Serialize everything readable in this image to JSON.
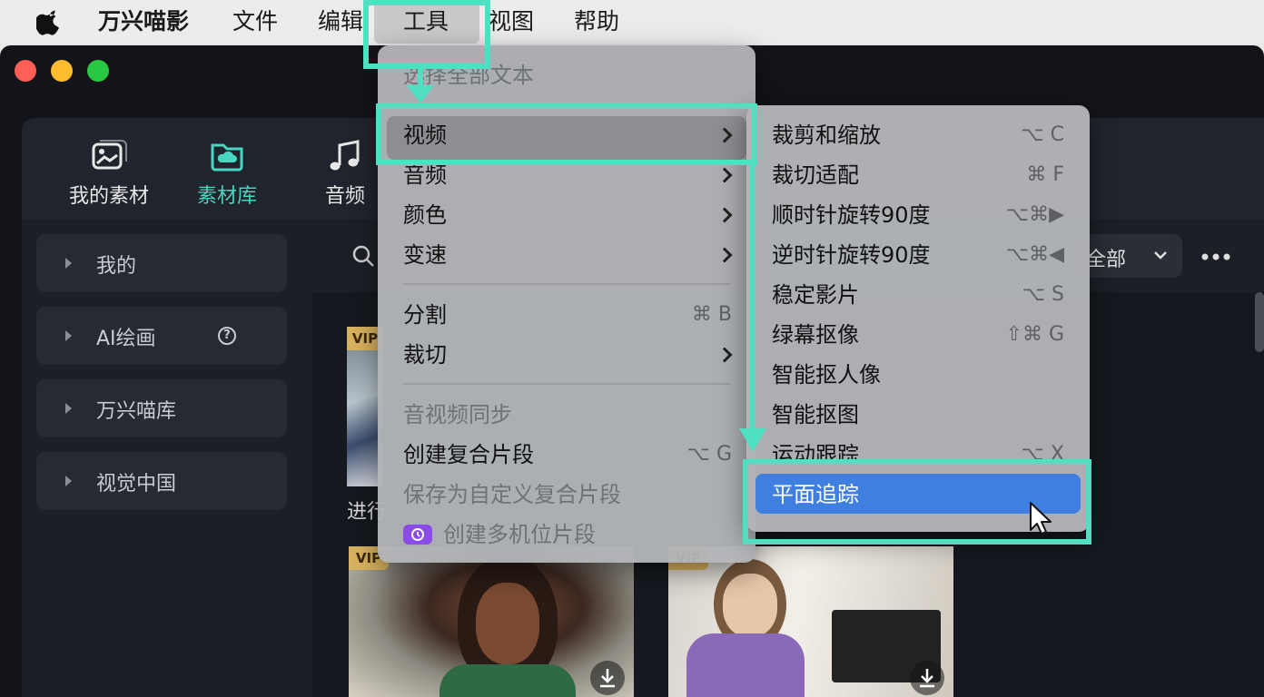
{
  "menubar": {
    "app_name": "万兴喵影",
    "items": [
      "文件",
      "编辑",
      "工具",
      "视图",
      "帮助"
    ]
  },
  "tabs": [
    {
      "label": "我的素材",
      "icon": "image-icon"
    },
    {
      "label": "素材库",
      "icon": "cloud-folder-icon"
    },
    {
      "label": "音频",
      "icon": "music-note-icon"
    }
  ],
  "sidebar": {
    "items": [
      {
        "label": "我的"
      },
      {
        "label": "AI绘画",
        "help": "?"
      },
      {
        "label": "万兴喵库"
      },
      {
        "label": "视觉中国"
      }
    ]
  },
  "toolbar": {
    "filter_label": "全部"
  },
  "thumbs": {
    "vip": "VIP",
    "caption": "进行"
  },
  "tools_menu": {
    "select_all_text": "选择全部文本",
    "video": "视频",
    "audio": "音频",
    "color": "颜色",
    "speed": "变速",
    "split": "分割",
    "split_shortcut": "⌘ B",
    "crop": "裁切",
    "av_sync": "音视频同步",
    "create_compound": "创建复合片段",
    "create_compound_shortcut": "⌥ G",
    "save_custom_compound": "保存为自定义复合片段",
    "create_multicam": "创建多机位片段"
  },
  "video_submenu": {
    "items": [
      {
        "label": "裁剪和缩放",
        "shortcut": "⌥ C"
      },
      {
        "label": "裁切适配",
        "shortcut": "⌘ F"
      },
      {
        "label": "顺时针旋转90度",
        "shortcut": "⌥⌘▶"
      },
      {
        "label": "逆时针旋转90度",
        "shortcut": "⌥⌘◀"
      },
      {
        "label": "稳定影片",
        "shortcut": "⌥ S"
      },
      {
        "label": "绿幕抠像",
        "shortcut": "⇧⌘ G"
      },
      {
        "label": "智能抠人像",
        "shortcut": ""
      },
      {
        "label": "智能抠图",
        "shortcut": ""
      },
      {
        "label": "运动跟踪",
        "shortcut": "⌥ X"
      },
      {
        "label": "平面追踪",
        "shortcut": ""
      }
    ]
  },
  "colors": {
    "accent": "#4fe0c2",
    "selection": "#3e7fe0",
    "brand_teal": "#49d6c0"
  }
}
